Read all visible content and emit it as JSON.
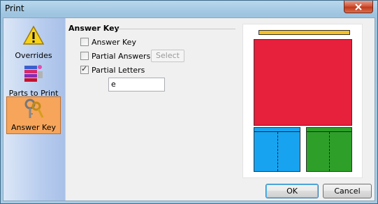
{
  "window": {
    "title": "Print"
  },
  "sidebar": {
    "items": [
      {
        "label": "Overrides",
        "icon": "warning-icon",
        "active": false
      },
      {
        "label": "Parts to Print",
        "icon": "parts-stack-icon",
        "active": false
      },
      {
        "label": "Answer Key",
        "icon": "keys-icon",
        "active": true
      }
    ]
  },
  "answer_key_group": {
    "title": "Answer Key",
    "answer_key": {
      "label": "Answer Key",
      "checked": false
    },
    "partial_answers": {
      "label": "Partial Answers",
      "checked": false
    },
    "select_button": "Select",
    "partial_letters": {
      "label": "Partial Letters",
      "checked": true
    },
    "letters_value": "e"
  },
  "preview": {
    "colors": {
      "bar": "#f4c024",
      "main": "#e7203c",
      "left": "#18a3f0",
      "right": "#2ea02a"
    }
  },
  "buttons": {
    "ok": "OK",
    "cancel": "Cancel"
  },
  "colors": {
    "active_nav": "#f6a55a",
    "close_button": "#c94a2c"
  }
}
